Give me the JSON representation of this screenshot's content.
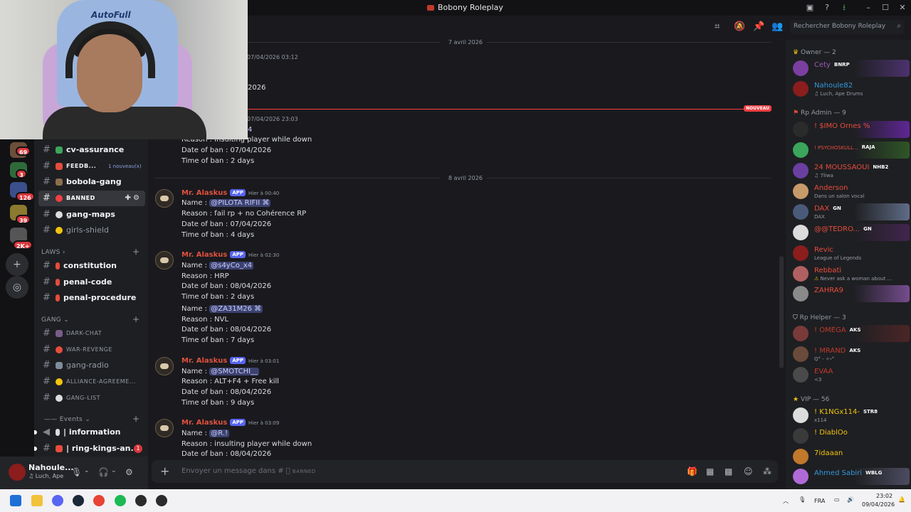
{
  "window": {
    "title": "Bobony Roleplay"
  },
  "webcam": {
    "brand": "AutoFull"
  },
  "search": {
    "placeholder": "Rechercher Bobony Roleplay"
  },
  "rail": {
    "badges": [
      "69",
      "3",
      "126",
      "39",
      "2K+"
    ]
  },
  "channels": {
    "items": [
      {
        "label": "cv-assurance",
        "style": "bold"
      },
      {
        "label": "FEEDB...",
        "style": "small",
        "tag": "1 nouveau(x)"
      },
      {
        "label": "bobola-gang",
        "style": "bold"
      },
      {
        "label": "BANNED",
        "style": "small-selected"
      },
      {
        "label": "gang-maps",
        "style": "bold"
      },
      {
        "label": "girls-shield",
        "style": "normal"
      }
    ],
    "laws_category": "LAWS",
    "laws": [
      "constitution",
      "penal-code",
      "penal-procedure"
    ],
    "gang_category": "GANG",
    "gang": [
      "DARK-CHAT",
      "WAR-REVENGE",
      "gang-radio",
      "ALLIANCE-AGREEME...",
      "GANG-LIST"
    ],
    "events_category": "Events",
    "events": [
      {
        "label": "| information"
      },
      {
        "label": "| ring-kings-an...",
        "badge": "1"
      }
    ]
  },
  "user": {
    "name": "Nahoule...",
    "status": "Luch, Ape"
  },
  "chat": {
    "date1": "7 avril 2026",
    "ts1": "07/04/2026 03:12",
    "partial1": "2026",
    "ts2": "07/04/2026 23:03",
    "new_label": "NOUVEAU",
    "partial2": "4",
    "prev_lines": [
      "Reason : insulting player while down",
      "Date of ban : 07/04/2026",
      "Time of ban : 2 days"
    ],
    "date2": "8 avril 2026",
    "messages": [
      {
        "author": "Mr. Alaskus",
        "badge": "APP",
        "time": "Hier à 00:40",
        "lines": [
          {
            "pre": "Name : ",
            "mention": "@PILOTA RIFII ⌘"
          },
          {
            "pre": "Reason : fail rp + no Cohérence RP"
          },
          {
            "pre": "Date of ban : 07/04/2026"
          },
          {
            "pre": "Time of ban : 4 days"
          }
        ]
      },
      {
        "author": "Mr. Alaskus",
        "badge": "APP",
        "time": "Hier à 02:30",
        "lines": [
          {
            "pre": "Name : ",
            "mention": "@s4yCo_x4"
          },
          {
            "pre": "Reason : HRP"
          },
          {
            "pre": "Date of ban : 08/04/2026"
          },
          {
            "pre": "Time of ban : 2 days"
          },
          {
            "pre": "Name : ",
            "mention": "@ZA31M26 ⌘"
          },
          {
            "pre": "Reason : NVL"
          },
          {
            "pre": "Date of ban : 08/04/2026"
          },
          {
            "pre": "Time of ban : 7 days"
          }
        ]
      },
      {
        "author": "Mr. Alaskus",
        "badge": "APP",
        "time": "Hier à 03:01",
        "lines": [
          {
            "pre": "Name : ",
            "mention": "@SMOTCHI__"
          },
          {
            "pre": "Reason : ALT+F4 + Free kill"
          },
          {
            "pre": "Date of ban : 08/04/2026"
          },
          {
            "pre": "Time of ban : 9 days"
          }
        ]
      },
      {
        "author": "Mr. Alaskus",
        "badge": "APP",
        "time": "Hier à 03:09",
        "lines": [
          {
            "pre": "Name : ",
            "mention": "@R.!"
          },
          {
            "pre": "Reason : insulting player while down"
          },
          {
            "pre": "Date of ban : 08/04/2026"
          }
        ]
      }
    ],
    "composer_placeholder": "Envoyer un message dans #",
    "composer_channel": "BANNED"
  },
  "members": {
    "groups": [
      {
        "title": "Owner — 2",
        "members": [
          {
            "name": "Cety",
            "tag": "BNRP",
            "color": "#9b59b6"
          },
          {
            "name": "Nahoule82",
            "sub": "♫ Luch, Ape Drums",
            "color": "#3498db"
          }
        ]
      },
      {
        "title": "Rp Admin — 9",
        "members": [
          {
            "name": "! $IMO Ornes %",
            "color": "#e74c3c"
          },
          {
            "name": "! PSYCHOSKULL...",
            "tag": "RAJA",
            "color": "#e74c3c"
          },
          {
            "name": "24 MOUSSAOUI",
            "tag": "NHB2",
            "sub": "♫ 7liwa",
            "color": "#e74c3c"
          },
          {
            "name": "Anderson",
            "sub": "Dans un salon vocal",
            "color": "#e74c3c"
          },
          {
            "name": "DAX",
            "tag": "GN",
            "sub": "DAX",
            "color": "#e74c3c"
          },
          {
            "name": "@@TEDRO...",
            "tag": "GN",
            "color": "#e74c3c"
          },
          {
            "name": "Revic",
            "sub": "League of Legends",
            "color": "#e74c3c"
          },
          {
            "name": "Rebbati",
            "sub": "Never ask a woman about ...",
            "color": "#e74c3c"
          },
          {
            "name": "ZAHRA9",
            "color": "#e74c3c"
          }
        ]
      },
      {
        "title": "Rp Helper — 3",
        "members": [
          {
            "name": "! OMEGA",
            "tag": "AKS",
            "color": "#c0392b"
          },
          {
            "name": "! MRAND",
            "tag": "AKS",
            "sub": "Q° - ✧˖°",
            "color": "#c0392b"
          },
          {
            "name": "EVAA",
            "sub": "<3",
            "color": "#c0392b"
          }
        ]
      },
      {
        "title": "VIP — 56",
        "members": [
          {
            "name": "! K1NGx114-",
            "tag": "STR8",
            "sub": "x114",
            "color": "#f1c40f"
          },
          {
            "name": "! DiablOo",
            "color": "#f1c40f"
          },
          {
            "name": "7idaaan",
            "color": "#f1c40f"
          },
          {
            "name": "Ahmed Sabiri",
            "tag": "WBLG",
            "color": "#3498db"
          }
        ]
      }
    ]
  },
  "taskbar": {
    "lang": "FRA",
    "time": "23:02",
    "date": "09/04/2026"
  }
}
